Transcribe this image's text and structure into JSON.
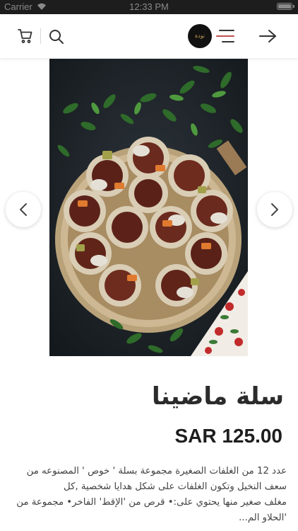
{
  "status_bar": {
    "carrier": "Carrier",
    "time": "12:33 PM",
    "battery_level": 1.0
  },
  "header": {
    "logo_text": "نودة",
    "icons": {
      "cart": "cart-icon",
      "search": "search-icon",
      "menu": "menu-icon",
      "back": "arrow-right-icon"
    }
  },
  "carousel": {
    "prev_icon": "chevron-left-icon",
    "next_icon": "chevron-right-icon"
  },
  "product": {
    "title": "سلة ماضينا",
    "price": "SAR 125.00",
    "description_lines": [
      "عدد 12 من الغلفات الصغيرة مجموعة بسلة ' خوص ' المصنوعه من",
      "سعف النخيل وتكون الغلفات على شكل هدايا شخصية ,كل",
      "مغلف صغير منها يحتوي على:• قرص من 'الإقط' الفاخر• مجموعة من",
      "'الحلاو الم..."
    ]
  },
  "colors": {
    "status_bar_bg": "#1d1d1d",
    "logo_gold": "#c89b52",
    "menu_accent": "#c0504d"
  }
}
